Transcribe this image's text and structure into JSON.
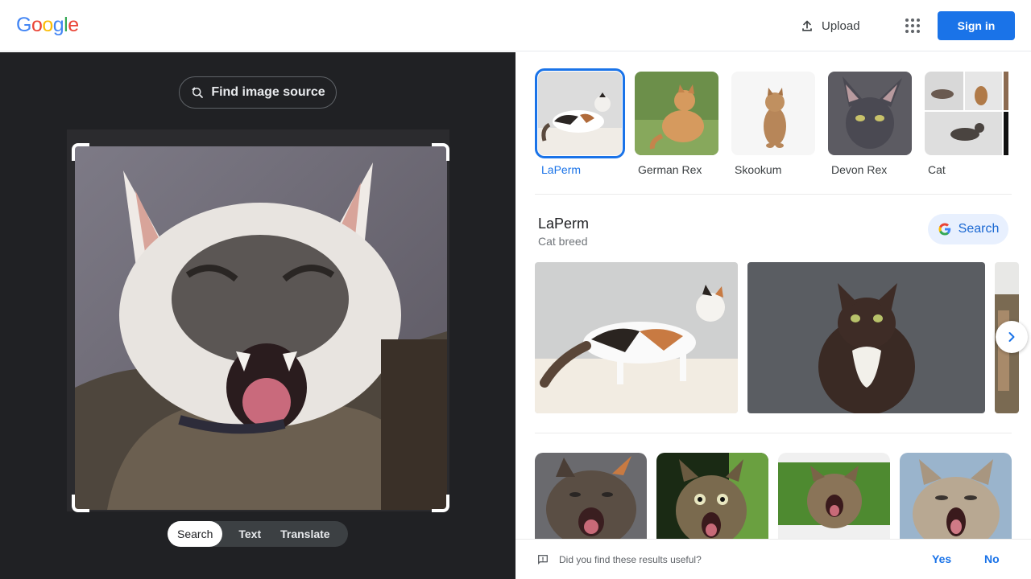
{
  "header": {
    "logo_letters": [
      {
        "ch": "G",
        "color": "#4285f4"
      },
      {
        "ch": "o",
        "color": "#ea4335"
      },
      {
        "ch": "o",
        "color": "#fbbc05"
      },
      {
        "ch": "g",
        "color": "#4285f4"
      },
      {
        "ch": "l",
        "color": "#34a853"
      },
      {
        "ch": "e",
        "color": "#ea4335"
      }
    ],
    "upload_label": "Upload",
    "upload_icon": "upload-icon",
    "apps_icon": "apps-grid-icon",
    "signin_label": "Sign in",
    "accent": "#1a73e8"
  },
  "lens": {
    "find_source_label": "Find image source",
    "modes": [
      "Search",
      "Text",
      "Translate"
    ],
    "active_mode": "Search"
  },
  "results": {
    "thumbnails": [
      {
        "label": "LaPerm",
        "selected": true
      },
      {
        "label": "German Rex",
        "selected": false
      },
      {
        "label": "Skookum",
        "selected": false
      },
      {
        "label": "Devon Rex",
        "selected": false
      },
      {
        "label": "Cat",
        "selected": false
      }
    ],
    "entity": {
      "title": "LaPerm",
      "subtitle": "Cat breed",
      "search_label": "Search"
    },
    "feedback": {
      "question": "Did you find these results useful?",
      "yes": "Yes",
      "no": "No"
    }
  }
}
